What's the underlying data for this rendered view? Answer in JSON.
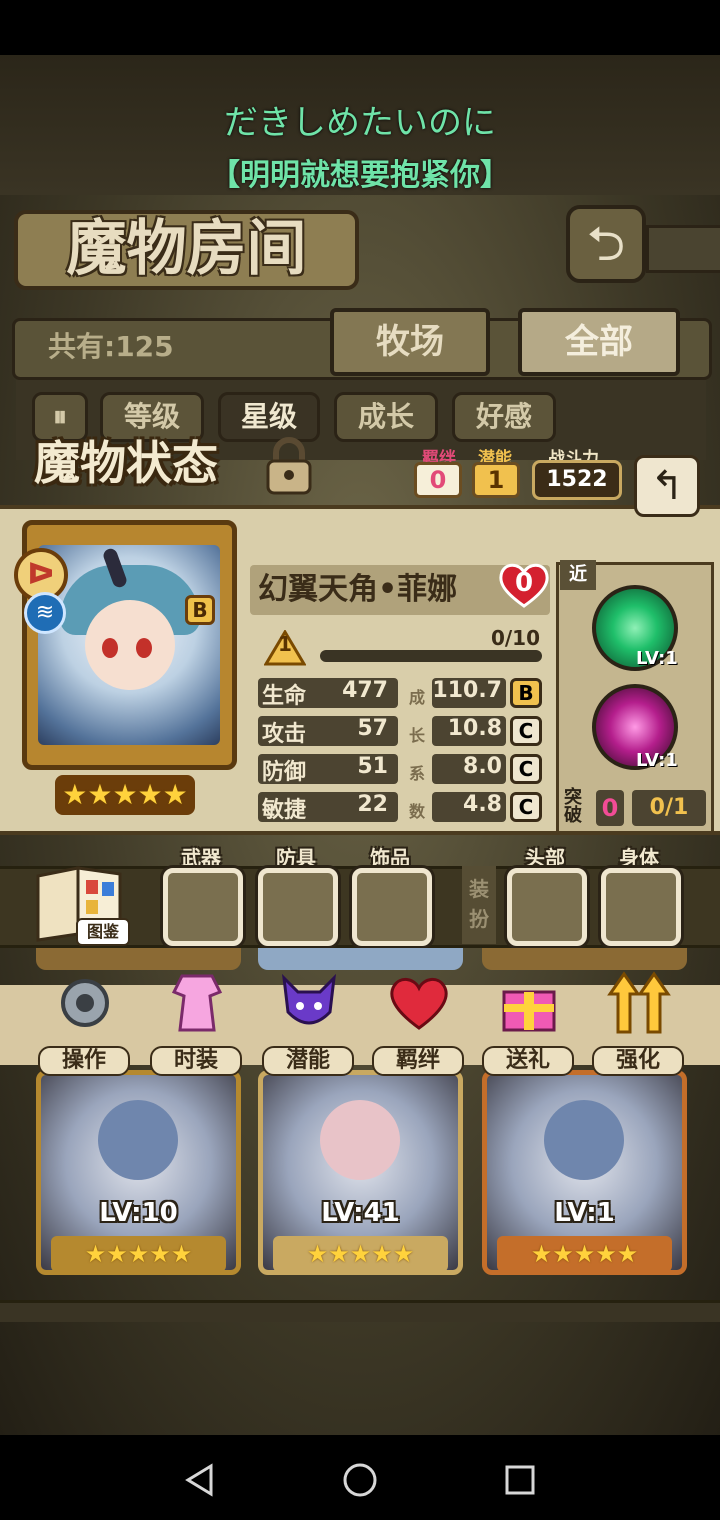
{
  "lyrics": {
    "line1": "だきしめたいのに",
    "line2": "【明明就想要抱紧你】"
  },
  "header": {
    "title": "魔物房间",
    "back_icon": "return-arrow-icon"
  },
  "filter": {
    "owned": "共有:125",
    "tabs": [
      "牧场",
      "全部"
    ],
    "active_tab": "全部"
  },
  "sort": {
    "pause_icon": "sort-order-icon",
    "buttons": [
      "等级",
      "星级",
      "成长",
      "好感"
    ],
    "active": "星级"
  },
  "status": {
    "title": "魔物状态",
    "bond_label": "羁绊",
    "bond_value": "0",
    "potential_label": "潜能",
    "potential_value": "1",
    "power_label": "战斗力",
    "power_value": "1522",
    "name": "幻翼天角•菲娜",
    "affection": "0",
    "level": "1",
    "exp": "0/10",
    "exp_fraction": 0,
    "grade": "B",
    "star_count": 5,
    "stats": [
      {
        "name": "生命",
        "value": "477",
        "growth": "110.7",
        "grade": "B"
      },
      {
        "name": "攻击",
        "value": "57",
        "growth": "10.8",
        "grade": "C"
      },
      {
        "name": "防御",
        "value": "51",
        "growth": "8.0",
        "grade": "C"
      },
      {
        "name": "敏捷",
        "value": "22",
        "growth": "4.8",
        "grade": "C"
      }
    ],
    "growth_vertical": [
      "成",
      "长",
      "系",
      "数"
    ],
    "range_tag": "近",
    "skills": [
      {
        "icon": "tree-skill-icon",
        "level": "LV:1",
        "color": "#1fbf6a"
      },
      {
        "icon": "sparkle-cross-skill-icon",
        "level": "LV:1",
        "color": "#e24ab8"
      }
    ],
    "break_label": "突破",
    "break_value": "0",
    "break_progress": "0/1"
  },
  "equipment": {
    "book_label": "图鉴",
    "slots": [
      "武器",
      "防具",
      "饰品",
      "头部",
      "身体"
    ],
    "divider": "装扮"
  },
  "actions": [
    {
      "label": "操作",
      "icon": "gear-icon"
    },
    {
      "label": "时装",
      "icon": "dress-icon"
    },
    {
      "label": "潜能",
      "icon": "demon-icon"
    },
    {
      "label": "羁绊",
      "icon": "hearts-icon"
    },
    {
      "label": "送礼",
      "icon": "gift-icon"
    },
    {
      "label": "强化",
      "icon": "up-arrows-icon"
    }
  ],
  "cards": [
    {
      "level": "LV:10",
      "stars": 5,
      "frame": "#b5892f"
    },
    {
      "level": "LV:41",
      "stars": 5,
      "frame": "#c9a961"
    },
    {
      "level": "LV:1",
      "stars": 5,
      "frame": "#c46e2a"
    }
  ],
  "colors": {
    "lyric": "#6fe3a8",
    "bond": "#e24a78",
    "star": "#ffd23c"
  }
}
